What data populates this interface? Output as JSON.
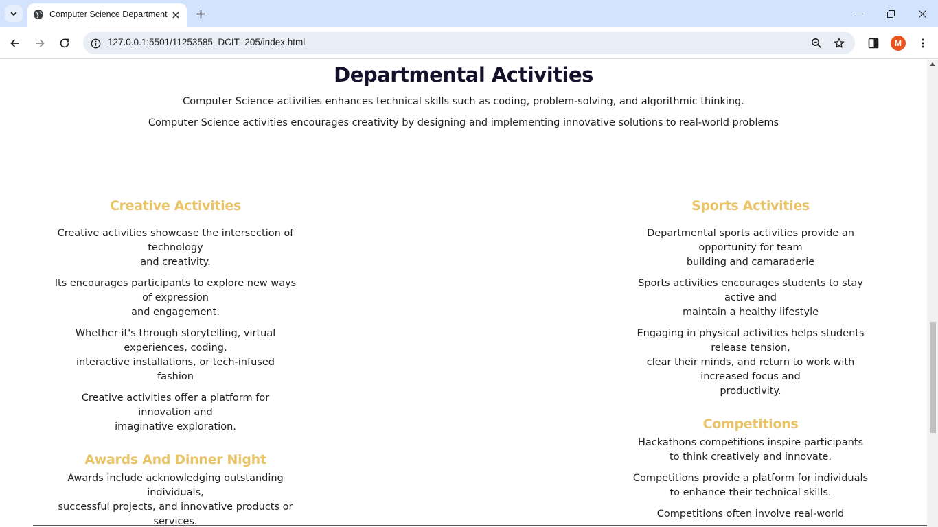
{
  "browser": {
    "tab_title": "Computer Science Department",
    "url": "127.0.0.1:5501/11253585_DCIT_205/index.html",
    "profile_initial": "M",
    "colors": {
      "tabstrip": "#d3e3fd",
      "avatar": "#e8531f"
    }
  },
  "page": {
    "heading": "Departmental Activities",
    "intro": [
      "Computer Science activities enhances technical skills such as coding, problem-solving, and algorithmic thinking.",
      "Computer Science activities encourages creativity by designing and implementing innovative solutions to real-world problems"
    ],
    "accent_color": "#e9c467",
    "creative": {
      "title": "Creative Activities",
      "paragraphs": [
        [
          "Creative activities showcase the intersection of technology",
          "and creativity."
        ],
        [
          "Its encourages participants to explore new ways of expression",
          "and engagement."
        ],
        [
          "Whether it's through storytelling, virtual experiences, coding,",
          "interactive installations, or tech-infused fashion"
        ],
        [
          "Creative activities offer a platform for innovation and",
          "imaginative exploration."
        ]
      ]
    },
    "awards": {
      "title": "Awards And Dinner Night",
      "paragraphs": [
        [
          "Awards include acknowledging outstanding individuals,",
          "successful projects, and innovative products or services."
        ]
      ]
    },
    "sports": {
      "title": "Sports Activities",
      "paragraphs": [
        [
          "Departmental sports activities provide an opportunity for team",
          "building and camaraderie"
        ],
        [
          "Sports activities encourages students to stay active and",
          "maintain a healthy lifestyle"
        ],
        [
          "Engaging in physical activities helps students release tension,",
          "clear their minds, and return to work with increased focus and",
          "productivity."
        ]
      ]
    },
    "competitions": {
      "title": "Competitions",
      "paragraphs": [
        [
          "Hackathons competitions inspire participants",
          "to think creatively and innovate."
        ],
        [
          "Competitions provide a platform for individuals",
          "to enhance their technical skills."
        ],
        [
          "Competitions often involve real-world"
        ]
      ]
    }
  }
}
